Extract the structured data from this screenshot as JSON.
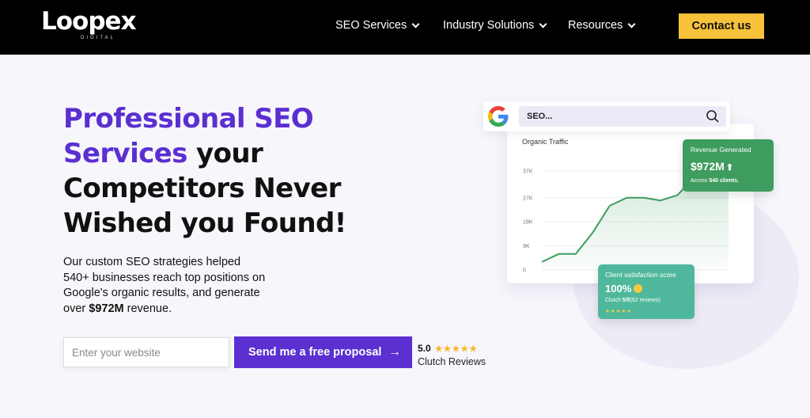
{
  "nav": {
    "logo": "Loopex",
    "logo_sub": "DIGITAL",
    "items": [
      {
        "label": "SEO Services"
      },
      {
        "label": "Industry Solutions"
      },
      {
        "label": "Resources"
      }
    ],
    "contact_label": "Contact us"
  },
  "hero": {
    "headline_accent": "Professional SEO Services",
    "headline_rest": " your Competitors Never Wished you Found!",
    "subtext_pre": "Our custom SEO strategies helped 540+ businesses reach top positions on Google's organic results, and generate over ",
    "subtext_bold": "$972M",
    "subtext_post": " revenue.",
    "input_placeholder": "Enter your website",
    "proposal_label": "Send me a free proposal",
    "proposal_arrow": "→",
    "rating_score": "5.0",
    "rating_stars": "★★★★★",
    "rating_label": "Clutch Reviews"
  },
  "search": {
    "query": "SEO..."
  },
  "chart": {
    "title": "Organic Traffic",
    "ticks": [
      "37K",
      "27K",
      "18K",
      "9K",
      "0"
    ]
  },
  "chart_data": {
    "type": "area",
    "title": "Organic Traffic",
    "xlabel": "",
    "ylabel": "",
    "ylim": [
      0,
      37000
    ],
    "y_ticks": [
      "0",
      "9K",
      "18K",
      "27K",
      "37K"
    ],
    "values": [
      3000,
      6000,
      6000,
      14000,
      24000,
      27000,
      27000,
      26000,
      28000,
      35000,
      37000,
      36000
    ],
    "color": "#3e9c5e"
  },
  "revenue": {
    "label": "Revenue Generated",
    "value": "$972M",
    "arrow": "⬆",
    "sub_pre": "Across ",
    "sub_bold": "540 clients."
  },
  "csat": {
    "label": "Client satisfaction score",
    "value": "100%",
    "sub_pre": "Clutch ",
    "sub_bold": "5/5",
    "sub_post": "(62 reviews)",
    "stars": "★★★★★"
  },
  "colors": {
    "accent": "#5b2fd0",
    "cta": "#f7c23a",
    "revenue_card": "#3e9c5e",
    "csat_card": "#4fb89c"
  }
}
